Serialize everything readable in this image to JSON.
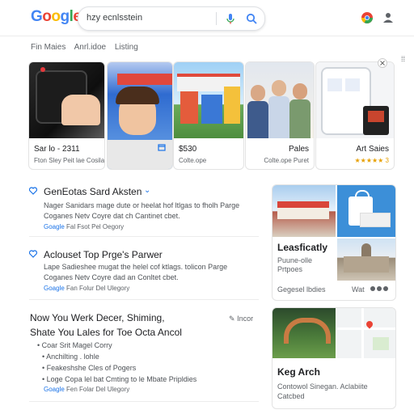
{
  "header": {
    "logo": [
      "G",
      "o",
      "o",
      "g",
      "l",
      "e"
    ],
    "logo_colors": [
      "#4285f4",
      "#ea4335",
      "#fbbc05",
      "#4285f4",
      "#34a853",
      "#ea4335"
    ],
    "search_value": "hzy ecnlsstein"
  },
  "tabs": [
    "Fin Maies",
    "Anrl.idoe",
    "Listing"
  ],
  "cards": [
    {
      "title": "Sar lo - 2311",
      "sub": "Fton Sley Peit lae Cosilac Doxiy"
    },
    {
      "title": "",
      "sub": ""
    },
    {
      "title": "$530",
      "sub": "Colte.ope"
    },
    {
      "title": "Pales",
      "sub": "Colte.ope Puret"
    },
    {
      "title": "Art Saies",
      "sub": "★★★★★ 3"
    }
  ],
  "results": [
    {
      "title": "GenEotas Sard Aksten",
      "lines": [
        "Nager Sanidars mage dute or heelat hof ltlgas to fholh Parge",
        "Coganes Netv Coyre dat ch Cantinet cbet."
      ],
      "source": "Goagle",
      "source_rest": "Fal Fsot Pel Oegory"
    },
    {
      "title": "Aclouset Top Prge's Parwer",
      "lines": [
        "Lape Sadieshee mugat the helel cof ktlags. tolicon Parge",
        "Coganes Netv Coyre dad an Conltet cbet."
      ],
      "source": "Goagle",
      "source_rest": "Fan Folur Del Ulegory"
    },
    {
      "title": "Now You Werk Decer, Shiming,",
      "title2": "Shate You Lales for Toe Octa Ancol",
      "bullets": [
        "Coar Srit Magel Corry",
        "Anchilting . lohle",
        "Feakeshshe Cles of Pogers",
        "Loge Copa lel bat Cmting to le Mbate Pripldies"
      ],
      "source": "Goagle",
      "source_rest": "Fen Folar Del Ulegory",
      "edit_label": "Incor"
    }
  ],
  "right": {
    "panel1_title": "Leasficatly",
    "panel1_lines": [
      "Puune-olle",
      "Prtpoes"
    ],
    "panel1_footer": "Gegesel lbdies",
    "panel1_footer2": "Wat",
    "panel2_title": "Keg Arch",
    "panel2_lines": [
      "Contowol Sinegan. Aclabiite",
      "Catcbed"
    ]
  }
}
